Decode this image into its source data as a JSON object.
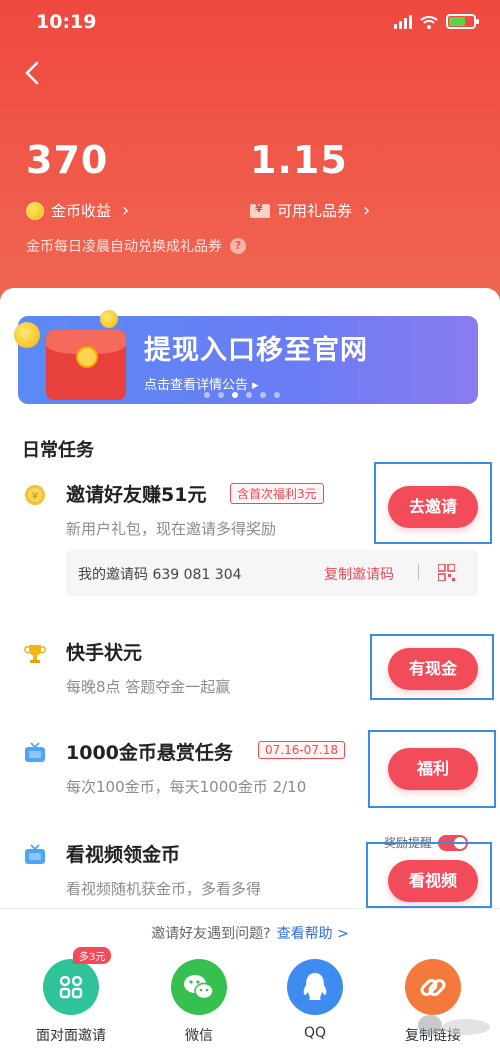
{
  "status_bar": {
    "time": "10:19"
  },
  "header": {
    "coin_value": "370",
    "coin_label": "金币收益",
    "coupon_value": "1.15",
    "coupon_label": "可用礼品券",
    "chevron": "›",
    "note": "金币每日凌晨自动兑换成礼品券",
    "help_mark": "?"
  },
  "banner": {
    "title": "提现入口移至官网",
    "subtitle": "点击查看详情公告 ▸"
  },
  "daily": {
    "section_title": "日常任务",
    "tasks": [
      {
        "icon": "coin-icon",
        "name": "邀请好友赚51元",
        "tag": "含首次福利3元",
        "desc": "新用户礼包，现在邀请多得奖励",
        "button": "去邀请"
      },
      {
        "icon": "trophy-icon",
        "name": "快手状元",
        "tag": "",
        "desc": "每晚8点 答题夺金一起赢",
        "button": "有现金"
      },
      {
        "icon": "tv-icon",
        "name": "1000金币悬赏任务",
        "tag": "07.16-07.18",
        "desc": "每次100金币，每天1000金币 2/10",
        "button": "福利"
      },
      {
        "icon": "tv-icon",
        "name": "看视频领金币",
        "tag": "",
        "desc": "看视频随机获金币，多看多得",
        "button": "看视频"
      }
    ],
    "invite_code_text": "我的邀请码 639 081 304",
    "copy_code": "复制邀请码",
    "reminder_label": "奖励提醒",
    "reminder_on": true
  },
  "share_panel": {
    "help_text": "邀请好友遇到问题?",
    "help_link": "查看帮助 >",
    "badge": "多3元",
    "items": [
      {
        "label": "面对面邀请",
        "icon": "face-to-face-icon",
        "color": "#2fc39a"
      },
      {
        "label": "微信",
        "icon": "wechat-icon",
        "color": "#35c04f"
      },
      {
        "label": "QQ",
        "icon": "qq-icon",
        "color": "#3f8cf0"
      },
      {
        "label": "复制链接",
        "icon": "link-icon",
        "color": "#f47a3b"
      }
    ]
  },
  "colors": {
    "header": "#f0493f",
    "accent": "#f24c5a",
    "highlight_box": "#3a8de0"
  }
}
